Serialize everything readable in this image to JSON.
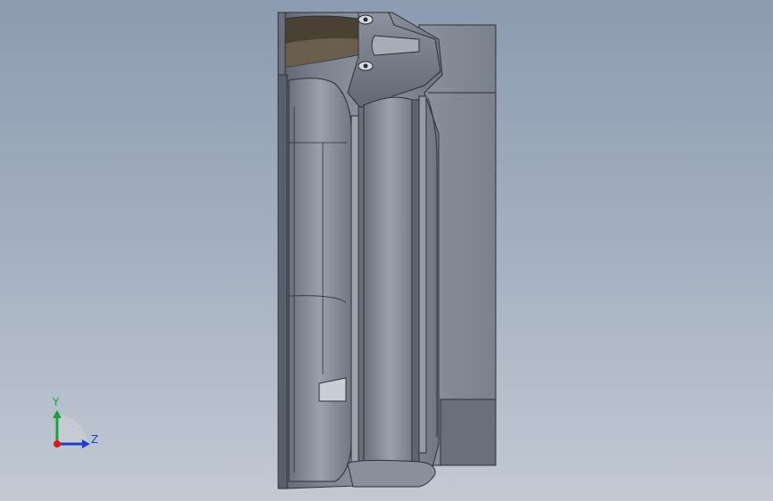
{
  "viewport": {
    "background_top": "#8c9bb0",
    "background_bottom": "#c2c9d3"
  },
  "model": {
    "body_color": "#7e8592",
    "edge_color": "#2c2f36",
    "inner_cavity_color": "#4a4033"
  },
  "triad": {
    "y_label": "Y",
    "z_label": "Z",
    "y_color": "#19a23c",
    "z_color": "#1f3fc4",
    "x_color": "#d01d1d",
    "y_icon": "arrow-up-icon",
    "z_icon": "arrow-right-icon",
    "origin_icon": "origin-dot-icon"
  }
}
